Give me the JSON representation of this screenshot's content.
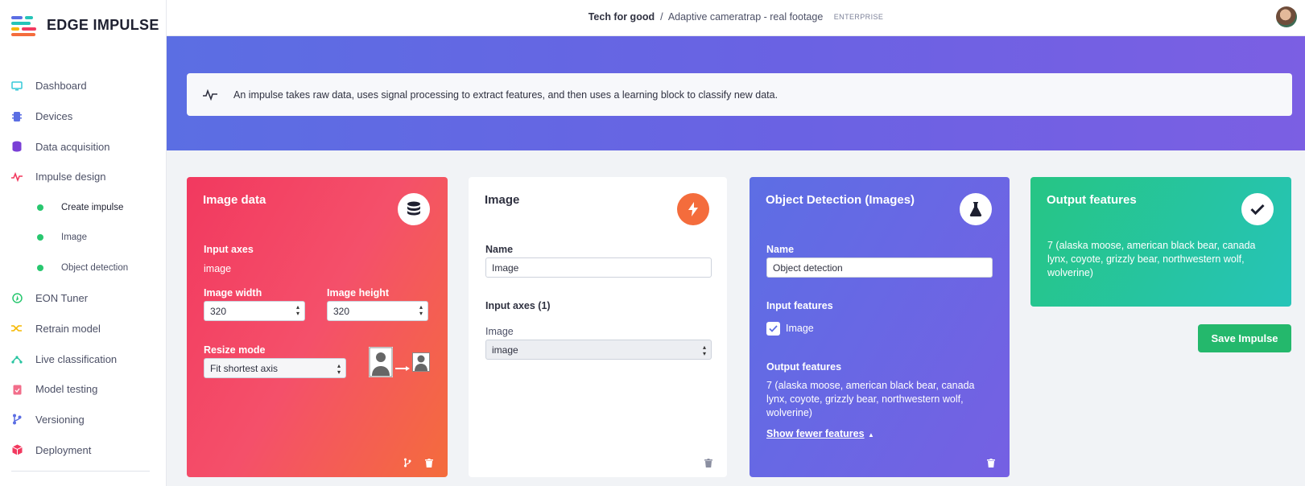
{
  "brand": {
    "name": "EDGE IMPULSE"
  },
  "breadcrumb": {
    "org": "Tech for good",
    "separator": "/",
    "project": "Adaptive cameratrap - real footage",
    "badge": "ENTERPRISE"
  },
  "sidebar": {
    "items": [
      {
        "label": "Dashboard",
        "icon": "monitor-icon",
        "color": "#35c8d8"
      },
      {
        "label": "Devices",
        "icon": "chip-icon",
        "color": "#5b6ee3"
      },
      {
        "label": "Data acquisition",
        "icon": "database-icon",
        "color": "#7a3fd6"
      },
      {
        "label": "Impulse design",
        "icon": "pulse-icon",
        "color": "#f2395f"
      }
    ],
    "sub_items": [
      {
        "label": "Create impulse"
      },
      {
        "label": "Image"
      },
      {
        "label": "Object detection"
      }
    ],
    "items_after": [
      {
        "label": "EON Tuner",
        "icon": "compass-icon",
        "color": "#28c76f"
      },
      {
        "label": "Retrain model",
        "icon": "shuffle-icon",
        "color": "#f5b800"
      },
      {
        "label": "Live classification",
        "icon": "network-icon",
        "color": "#26c4a0"
      },
      {
        "label": "Model testing",
        "icon": "clipboard-icon",
        "color": "#f26d8a"
      },
      {
        "label": "Versioning",
        "icon": "branch-icon",
        "color": "#5b6ee3"
      },
      {
        "label": "Deployment",
        "icon": "box-icon",
        "color": "#f2395f"
      }
    ]
  },
  "info": {
    "text": "An impulse takes raw data, uses signal processing to extract features, and then uses a learning block to classify new data."
  },
  "image_data_block": {
    "title": "Image data",
    "input_axes_label": "Input axes",
    "input_axes_value": "image",
    "width_label": "Image width",
    "width_value": "320",
    "height_label": "Image height",
    "height_value": "320",
    "resize_label": "Resize mode",
    "resize_value": "Fit shortest axis"
  },
  "image_block": {
    "title": "Image",
    "name_label": "Name",
    "name_value": "Image",
    "input_axes_label": "Input axes (1)",
    "axis_label": "Image",
    "axis_value": "image"
  },
  "od_block": {
    "title": "Object Detection (Images)",
    "name_label": "Name",
    "name_value": "Object detection",
    "input_features_label": "Input features",
    "input_feature_item": "Image",
    "output_features_label": "Output features",
    "output_features_value": "7 (alaska moose, american black bear, canada lynx, coyote, grizzly bear, northwestern wolf, wolverine)",
    "toggle_link": "Show fewer features"
  },
  "output_block": {
    "title": "Output features",
    "value": "7 (alaska moose, american black bear, canada lynx, coyote, grizzly bear, northwestern wolf, wolverine)"
  },
  "actions": {
    "save_label": "Save Impulse"
  }
}
